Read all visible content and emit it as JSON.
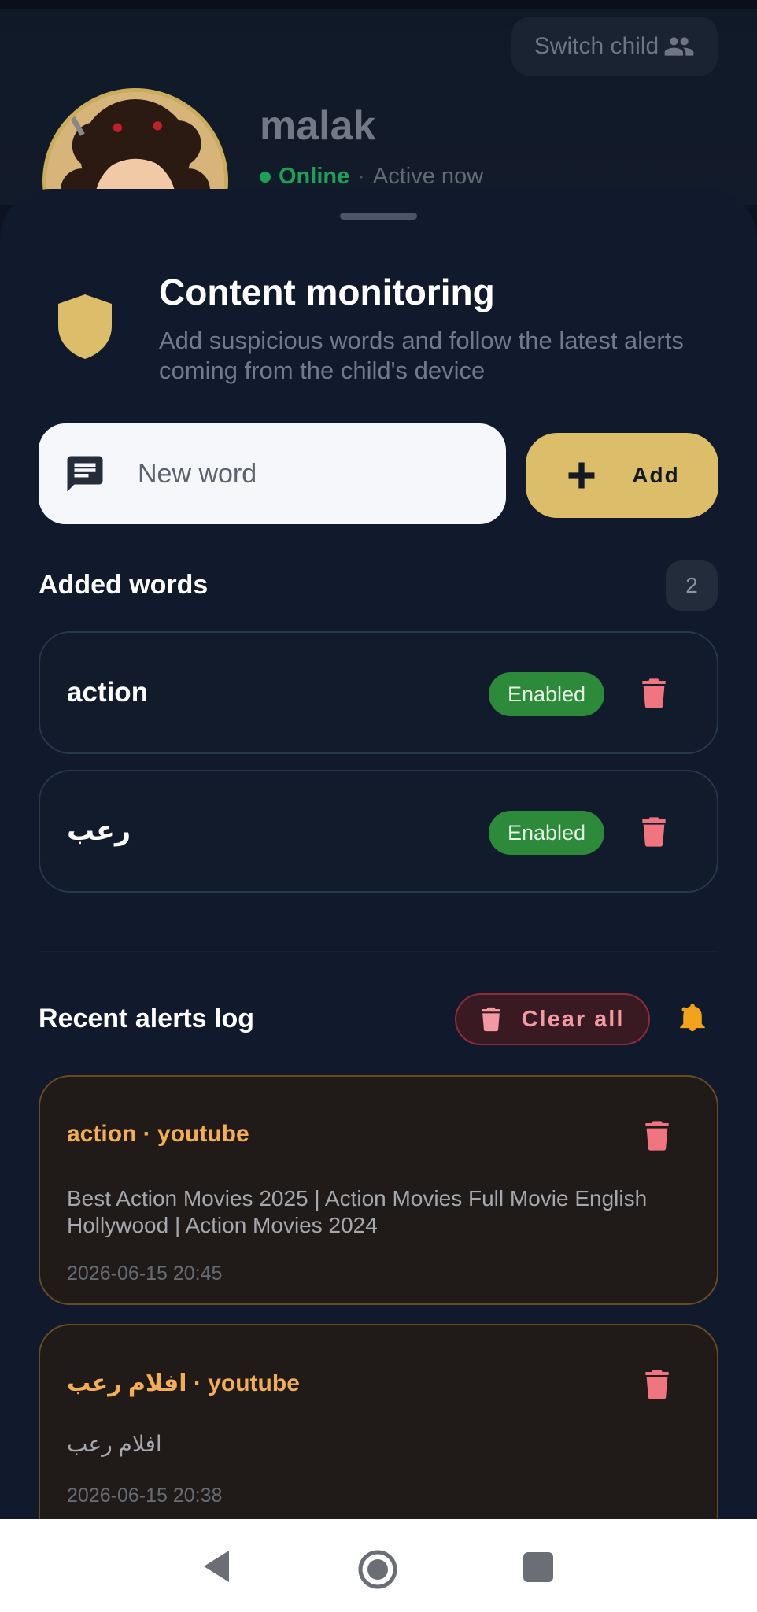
{
  "header": {
    "switch_label": "Switch child",
    "child_name": "malak",
    "status_online": "Online",
    "status_separator": "·",
    "status_active": "Active now"
  },
  "sheet": {
    "title": "Content monitoring",
    "subtitle": "Add suspicious words and follow the latest alerts coming from the child's device",
    "input_placeholder": "New word",
    "add_label": "Add",
    "added_words_title": "Added words",
    "added_words_count": "2",
    "words": [
      {
        "word": "action",
        "status": "Enabled"
      },
      {
        "word": "رعب",
        "status": "Enabled"
      }
    ],
    "alerts_title": "Recent alerts log",
    "clear_all_label": "Clear all",
    "alerts": [
      {
        "title": "action · youtube",
        "body": "Best Action Movies 2025 | Action Movies Full Movie English Hollywood | Action Movies 2024",
        "time": "2026-06-15 20:45"
      },
      {
        "title": "افلام رعب · youtube",
        "body": "افلام رعب",
        "time": "2026-06-15 20:38"
      }
    ]
  },
  "colors": {
    "accent_gold": "#dbbd6a",
    "online_green": "#1f9e58",
    "enabled_green": "#2c8a3a",
    "alert_orange": "#f2ad55",
    "danger_red": "#f07580"
  },
  "icons": {
    "switch": "people-icon",
    "shield": "shield-icon",
    "input": "message-icon",
    "add": "plus-icon",
    "delete": "trash-icon",
    "bell": "bell-icon"
  }
}
